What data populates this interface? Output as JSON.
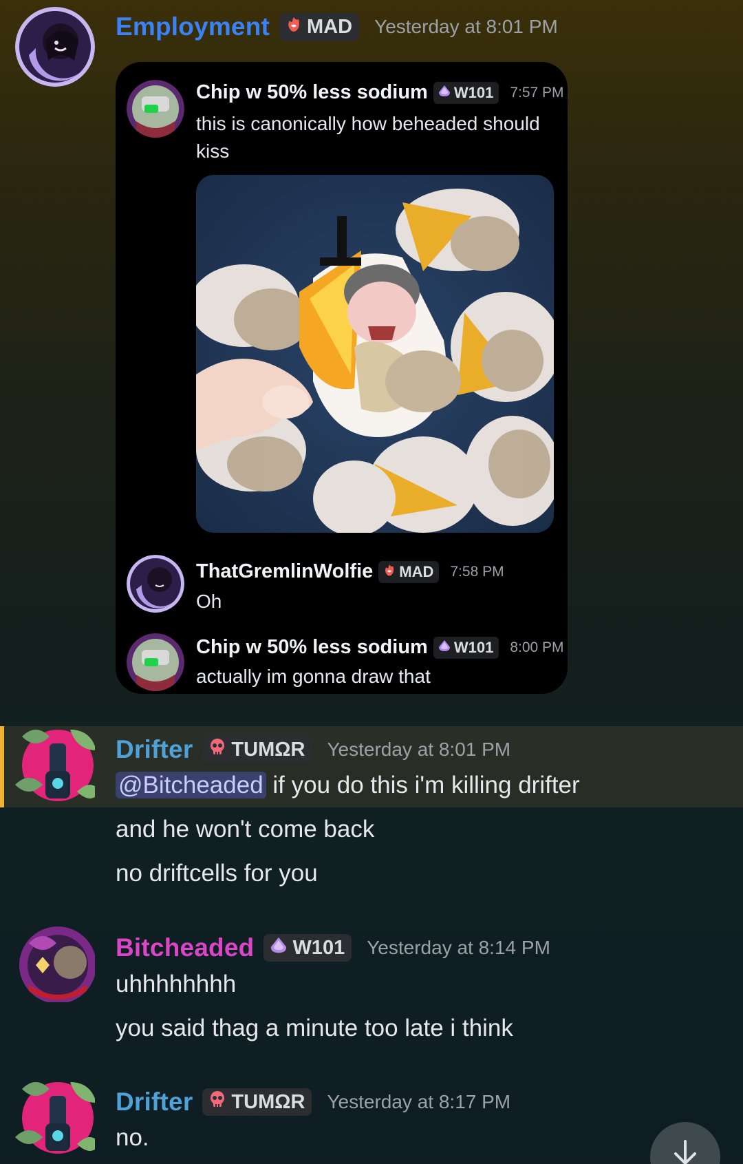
{
  "messages": [
    {
      "author": "Employment",
      "author_color": "#3b82f6",
      "tag": "MAD",
      "timestamp": "Yesterday at 8:01 PM",
      "forwarded": {
        "items": [
          {
            "author": "Chip w 50% less sodium",
            "tag": "W101",
            "timestamp": "7:57 PM",
            "lines": [
              "this is canonically how beheaded should",
              "kiss"
            ]
          },
          {
            "author": "ThatGremlinWolfie",
            "tag": "MAD",
            "timestamp": "7:58 PM",
            "lines": [
              "Oh"
            ]
          },
          {
            "author": "Chip w 50% less sodium",
            "tag": "W101",
            "timestamp": "8:00 PM",
            "lines": [
              "actually im gonna draw that"
            ]
          }
        ]
      }
    },
    {
      "author": "Drifter",
      "author_color": "#4ea2d8",
      "tag": "TUMΩR",
      "timestamp": "Yesterday at 8:01 PM",
      "mention": "@Bitcheaded",
      "lines": [
        " if you do this i'm killing drifter",
        "and he won't come back",
        "no driftcells for you"
      ]
    },
    {
      "author": "Bitcheaded",
      "author_color": "#d946c6",
      "tag": "W101",
      "timestamp": "Yesterday at 8:14 PM",
      "lines": [
        "uhhhhhhhh",
        "you said thag a minute too late i think"
      ]
    },
    {
      "author": "Drifter",
      "author_color": "#4ea2d8",
      "tag": "TUMΩR",
      "timestamp": "Yesterday at 8:17 PM",
      "lines": [
        "no."
      ]
    }
  ],
  "icons": {
    "mad": "flame-heart-icon",
    "w101": "purple-drop-icon",
    "tumor": "skull-icon",
    "scroll": "arrow-down-icon"
  }
}
